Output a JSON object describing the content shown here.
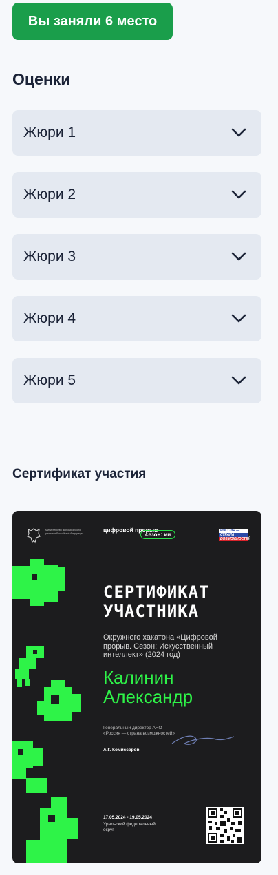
{
  "result": {
    "place_label": "Вы заняли 6 место"
  },
  "scores": {
    "title": "Оценки",
    "jury": [
      {
        "label": "Жюри 1"
      },
      {
        "label": "Жюри 2"
      },
      {
        "label": "Жюри 3"
      },
      {
        "label": "Жюри 4"
      },
      {
        "label": "Жюри 5"
      }
    ]
  },
  "certificate": {
    "section_title": "Сертификат участия",
    "ministry": "Министерство экономического развития Российской Федерации",
    "logo": "цифровой прорыв",
    "season": "сезон: ии",
    "russia_brand": [
      "РОССИЯ —",
      "СТРАНА",
      "ВОЗМОЖНОСТЕЙ"
    ],
    "heading": "СЕРТИФИКАТ УЧАСТНИКА",
    "description": "Окружного хакатона «Цифровой прорыв. Сезон: Искусственный интеллект» (2024 год)",
    "recipient": "Калинин Александр",
    "signer_position": "Генеральный директор АНО «Россия — страна возможностей»",
    "signer_name": "А.Г. Комиссаров",
    "dates": "17.05.2024 - 19.05.2024",
    "district": "Уральский федеральный округ",
    "colors": {
      "background": "#1c1c1e",
      "accent": "#2ef348"
    }
  },
  "colors": {
    "badge": "#1a9e4b",
    "card": "#e4e9f1",
    "page": "#f6f8fb"
  },
  "icons": {
    "accordion": "chevron-down-icon"
  }
}
